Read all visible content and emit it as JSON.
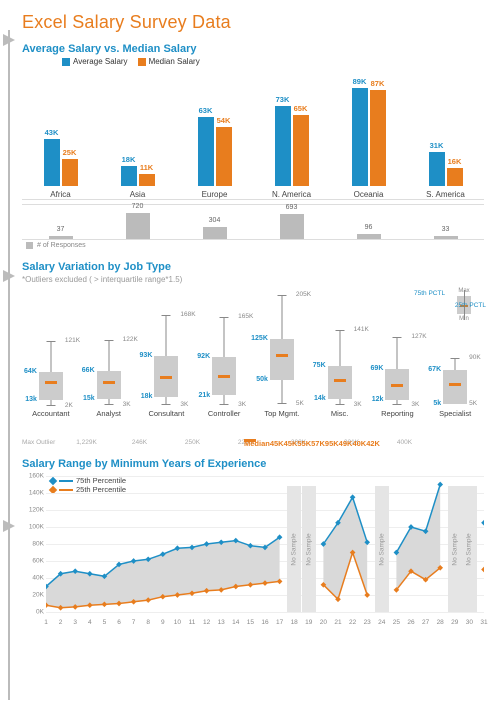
{
  "title": "Excel Salary Survey Data",
  "section1": {
    "title": "Average Salary vs. Median Salary",
    "legend_avg": "Average Salary",
    "legend_med": "Median Salary",
    "responses_label": "# of Responses"
  },
  "section2": {
    "title": "Salary Variation by Job Type",
    "note": "*Outliers excluded ( > interquartile range*1.5)",
    "leg_75": "75th PCTL",
    "leg_25": "25th PCTL",
    "leg_max": "Max",
    "leg_min": "Min",
    "median_hdr": "Median",
    "outlier_hdr": "Max Outlier"
  },
  "section3": {
    "title": "Salary Range by Minimum Years of Experience",
    "leg_75": "75th Percentile",
    "leg_25": "25th Percentile",
    "no_sample": "No Sample"
  },
  "chart_data": [
    {
      "type": "bar",
      "title": "Average Salary vs. Median Salary",
      "categories": [
        "Africa",
        "Asia",
        "Europe",
        "N. America",
        "Oceania",
        "S. America"
      ],
      "series": [
        {
          "name": "Average Salary",
          "values": [
            43,
            18,
            63,
            73,
            89,
            31
          ],
          "unit": "K"
        },
        {
          "name": "Median Salary",
          "values": [
            25,
            11,
            54,
            65,
            87,
            16
          ],
          "unit": "K"
        }
      ],
      "sub_series": {
        "name": "# of Responses",
        "values": [
          37,
          720,
          304,
          693,
          96,
          33
        ]
      },
      "ylim": [
        0,
        100
      ]
    },
    {
      "type": "box",
      "title": "Salary Variation by Job Type",
      "categories": [
        "Accountant",
        "Analyst",
        "Consultant",
        "Controller",
        "Top Mgmt.",
        "Misc.",
        "Reporting",
        "Specialist"
      ],
      "boxes": [
        {
          "min": 2,
          "q1": 13,
          "median": 45,
          "q3": 64,
          "max": 121
        },
        {
          "min": 3,
          "q1": 15,
          "median": 45,
          "q3": 66,
          "max": 122
        },
        {
          "min": 3,
          "q1": 18,
          "median": 55,
          "q3": 93,
          "max": 168
        },
        {
          "min": 3,
          "q1": 21,
          "median": 57,
          "q3": 92,
          "max": 165
        },
        {
          "min": 5,
          "q1": 50,
          "median": 95,
          "q3": 125,
          "max": 205
        },
        {
          "min": 3,
          "q1": 14,
          "median": 49,
          "q3": 75,
          "max": 141
        },
        {
          "min": 3,
          "q1": 12,
          "median": 40,
          "q3": 69,
          "max": 127
        },
        {
          "min": 5,
          "q1": 5,
          "median": 42,
          "q3": 67,
          "max": 90
        }
      ],
      "unit": "K",
      "median_row": [
        "45K",
        "45K",
        "55K",
        "57K",
        "95K",
        "49K",
        "40K",
        "42K"
      ],
      "outlier_row": [
        "1,229K",
        "246K",
        "250K",
        "229K",
        "300K",
        "231K",
        "400K",
        ""
      ],
      "ylim": [
        0,
        210
      ]
    },
    {
      "type": "area",
      "title": "Salary Range by Minimum Years of Experience",
      "x": [
        1,
        2,
        3,
        4,
        5,
        6,
        7,
        8,
        9,
        10,
        11,
        12,
        13,
        14,
        15,
        16,
        17,
        18,
        19,
        20,
        21,
        22,
        23,
        24,
        25,
        26,
        27,
        28,
        29,
        30,
        31
      ],
      "series": [
        {
          "name": "75th Percentile",
          "values": [
            30,
            45,
            48,
            45,
            42,
            56,
            60,
            62,
            68,
            75,
            76,
            80,
            82,
            84,
            78,
            76,
            88,
            null,
            null,
            80,
            105,
            135,
            82,
            null,
            70,
            100,
            95,
            150,
            null,
            null,
            105
          ]
        },
        {
          "name": "25th Percentile",
          "values": [
            8,
            5,
            6,
            8,
            9,
            10,
            12,
            14,
            18,
            20,
            22,
            25,
            26,
            30,
            32,
            34,
            36,
            null,
            null,
            32,
            15,
            70,
            20,
            null,
            26,
            48,
            38,
            52,
            null,
            null,
            50
          ]
        }
      ],
      "no_sample_x": [
        18,
        19,
        24,
        29,
        30
      ],
      "ylim": [
        0,
        160
      ],
      "ylabel": "K",
      "xlabel": ""
    }
  ]
}
